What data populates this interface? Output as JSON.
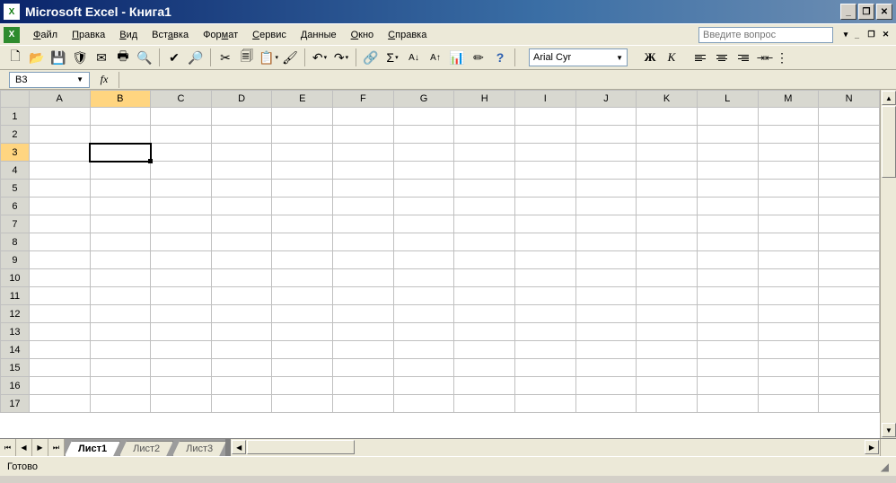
{
  "title": "Microsoft Excel - Книга1",
  "menu": {
    "items": [
      {
        "u": "Ф",
        "rest": "айл"
      },
      {
        "u": "П",
        "rest": "равка"
      },
      {
        "u": "В",
        "rest": "ид"
      },
      {
        "u": "",
        "rest": "Вст",
        "u2": "а",
        "rest2": "вка"
      },
      {
        "u": "",
        "rest": "Фор",
        "u2": "м",
        "rest2": "ат"
      },
      {
        "u": "С",
        "rest": "ервис"
      },
      {
        "u": "Д",
        "rest": "анные"
      },
      {
        "u": "О",
        "rest": "кно"
      },
      {
        "u": "С",
        "rest": "правка"
      }
    ],
    "file": "Файл",
    "edit": "Правка",
    "view": "Вид",
    "insert": "Вставка",
    "format": "Формат",
    "tools": "Сервис",
    "data": "Данные",
    "window": "Окно",
    "help": "Справка",
    "help_placeholder": "Введите вопрос"
  },
  "toolbar": {
    "font_name": "Arial Cyr",
    "bold": "Ж",
    "italic": "К"
  },
  "namebox": "B3",
  "fx": "fx",
  "columns": [
    "A",
    "B",
    "C",
    "D",
    "E",
    "F",
    "G",
    "H",
    "I",
    "J",
    "K",
    "L",
    "M",
    "N"
  ],
  "rows": [
    "1",
    "2",
    "3",
    "4",
    "5",
    "6",
    "7",
    "8",
    "9",
    "10",
    "11",
    "12",
    "13",
    "14",
    "15",
    "16",
    "17"
  ],
  "active_cell": {
    "row": 3,
    "col": "B"
  },
  "sheets": {
    "active": "Лист1",
    "tabs": [
      "Лист1",
      "Лист2",
      "Лист3"
    ]
  },
  "status": "Готово"
}
